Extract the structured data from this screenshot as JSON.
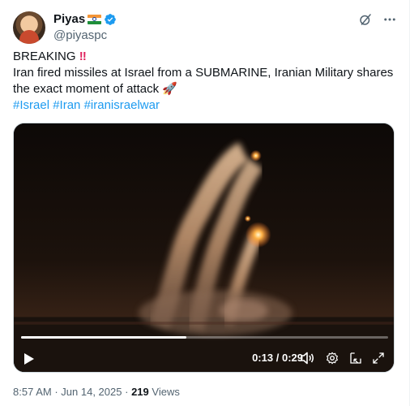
{
  "author": {
    "display_name": "Piyas",
    "handle": "@piyaspc"
  },
  "post": {
    "line1": "BREAKING",
    "line1_emoji": "‼",
    "line2": "Iran fired missiles at Israel from a SUBMARINE, Iranian Military shares the exact moment of attack",
    "line2_emoji": "🚀",
    "hashtags": [
      "#Israel",
      "#Iran",
      "#iranisraelwar"
    ]
  },
  "video": {
    "current_time": "0:13",
    "duration": "0:29",
    "progress_fraction": 0.45,
    "time_separator": "/"
  },
  "meta": {
    "time": "8:57 AM",
    "date": "Jun 14, 2025",
    "separator": "·",
    "views_count": "219",
    "views_label": "Views"
  },
  "colors": {
    "link": "#1d9bf0",
    "secondary_text": "#536471",
    "verified": "#1d9bf0"
  }
}
